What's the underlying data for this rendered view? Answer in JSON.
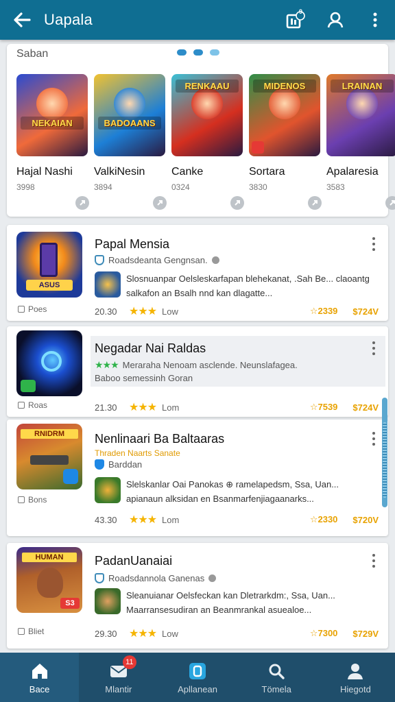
{
  "appbar": {
    "title": "Uapala",
    "notif_count": "9"
  },
  "featured": {
    "title": "Saban",
    "tiles": [
      {
        "name": "Hajal Nashi",
        "meta": "3998",
        "banner": "NEKAIAN",
        "colors": [
          "#f06a3a",
          "#2a4bd1"
        ]
      },
      {
        "name": "ValkiNesin",
        "meta": "3894",
        "banner": "BADOAANS",
        "colors": [
          "#1d7fd6",
          "#f2c230"
        ]
      },
      {
        "name": "Canke",
        "meta": "0324",
        "banner": "RENKAAU",
        "colors": [
          "#d52f1f",
          "#39c0d6"
        ]
      },
      {
        "name": "Sortara",
        "meta": "3830",
        "banner": "MIDENOS",
        "colors": [
          "#e1542d",
          "#2f8e48"
        ]
      },
      {
        "name": "Apalaresia",
        "meta": "3583",
        "banner": "LRAINAN",
        "colors": [
          "#6b3fb0",
          "#e07a2a"
        ]
      }
    ]
  },
  "items": [
    {
      "name": "Papal Mensia",
      "developer": "Roadsdeanta Gengnsan.",
      "desc": "Slosnuanpar Oelsleskarfapan blehekanat, .Sah Be... claoantg salkafon an Bsalh nnd kan dlagatte...",
      "tag": "Poes",
      "size": "20.30",
      "label": "Low",
      "rank": "2339",
      "price": "$724V"
    },
    {
      "name": "Negadar Nai Raldas",
      "developer": "Meraraha Nenoam asclende. Neunslafagea.",
      "desc_line": "Baboo semessinh Goran",
      "tag": "Roas",
      "size": "21.30",
      "label": "Lom",
      "rank": "7539",
      "price": "$724V"
    },
    {
      "name": "Nenlinaari Ba Baltaaras",
      "subtitle": "Thraden Naarts Sanate",
      "developer": "Barddan",
      "desc": "Slelskanlar Oai Panokas ⊕ ramelapedsm, Ssa, Uan... apianaun alksidan en Bsanmarfenjiagaanarks...",
      "tag": "Bons",
      "size": "43.30",
      "label": "Lom",
      "rank": "2330",
      "price": "$720V"
    },
    {
      "name": "PadanUanaiai",
      "developer": "Roadsdannola Ganenas",
      "desc": "Sleanuianar Oelsfeckan kan Dletrarkdm:, Ssa, Uan... Maarransesudiran an Beanmrankal asuealoe...",
      "tag": "Bliet",
      "size": "29.30",
      "label": "Low",
      "rank": "7300",
      "price": "$729V"
    }
  ],
  "nav": [
    {
      "label": "Bace"
    },
    {
      "label": "Mlantir",
      "count": "11"
    },
    {
      "label": "Apllanean"
    },
    {
      "label": "Tömela"
    },
    {
      "label": "Hiegotd"
    }
  ],
  "colors": {
    "appbar": "#0f6e92",
    "accent": "#2d8dc9",
    "star": "#f5b400",
    "nav_bg": "#1f4e6b"
  }
}
